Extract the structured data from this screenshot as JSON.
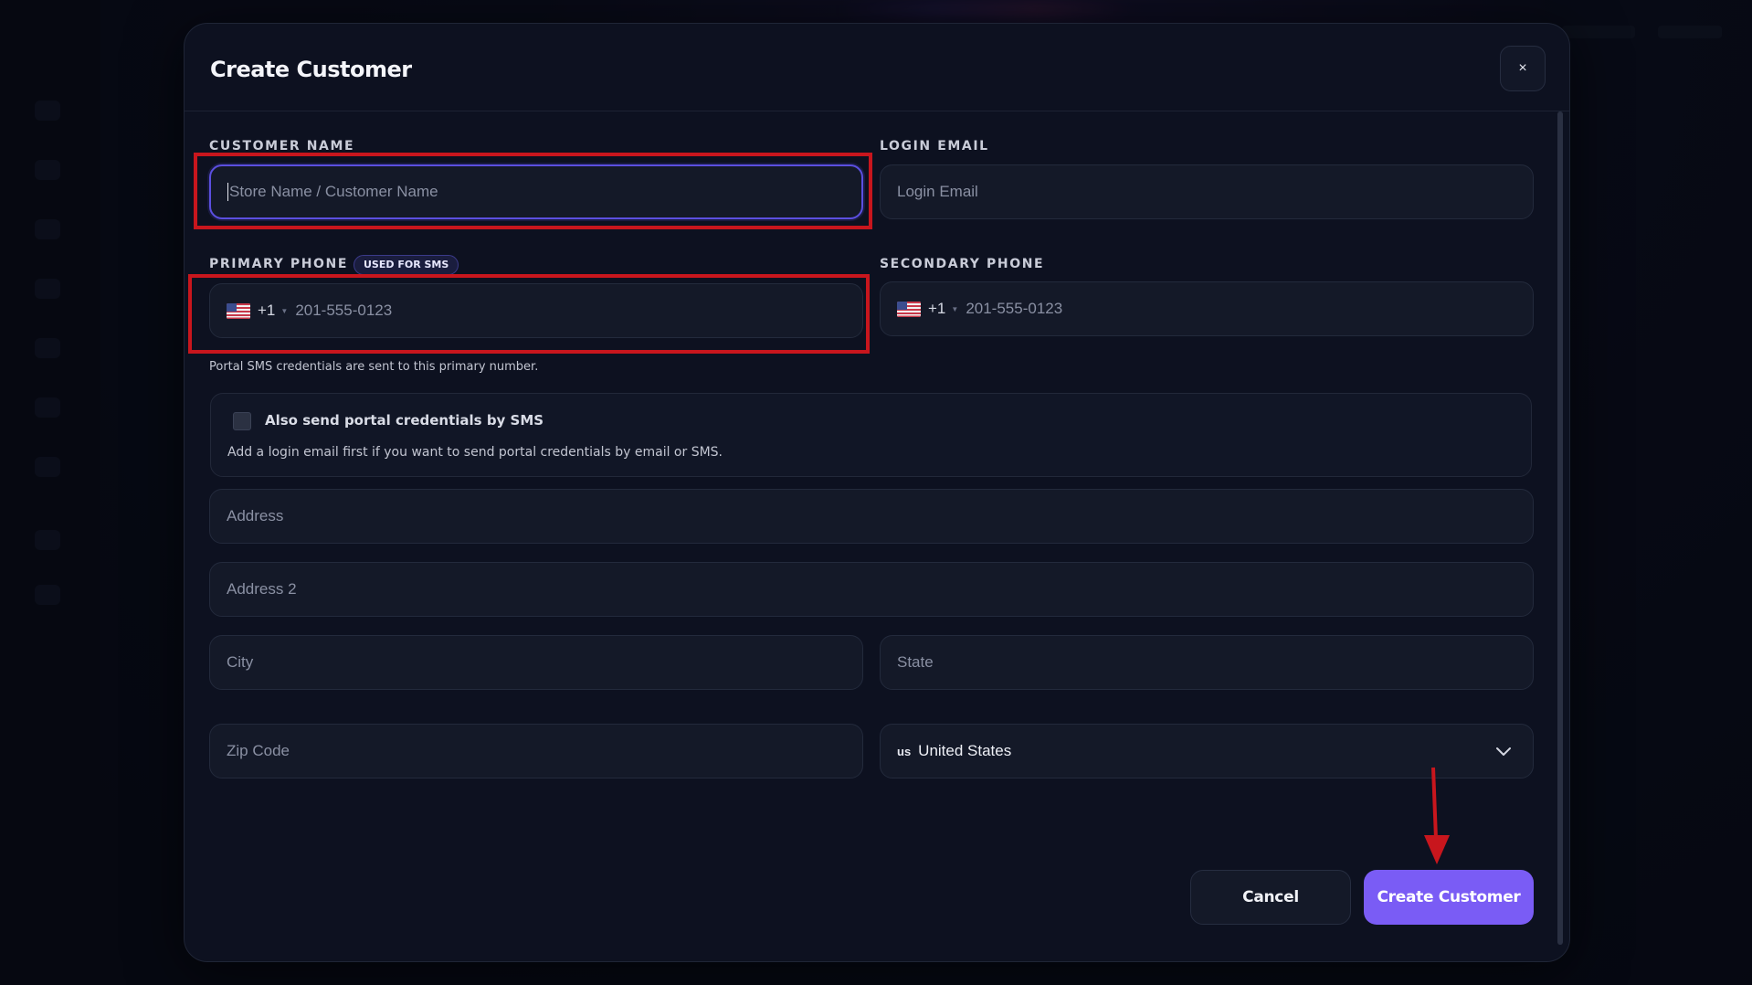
{
  "modal": {
    "title": "Create Customer",
    "close_label": "×"
  },
  "form": {
    "customer_name": {
      "label": "CUSTOMER NAME",
      "placeholder": "Store Name / Customer Name",
      "value": ""
    },
    "login_email": {
      "label": "LOGIN EMAIL",
      "placeholder": "Login Email",
      "value": ""
    },
    "primary_phone": {
      "label": "PRIMARY PHONE",
      "badge": "USED FOR SMS",
      "dial_code": "+1",
      "placeholder": "201-555-0123",
      "help": "Portal SMS credentials are sent to this primary number."
    },
    "secondary_phone": {
      "label": "SECONDARY PHONE",
      "dial_code": "+1",
      "placeholder": "201-555-0123"
    },
    "sms_option": {
      "checked": false,
      "label": "Also send portal credentials by SMS",
      "description": "Add a login email first if you want to send portal credentials by email or SMS."
    },
    "address": {
      "placeholder": "Address"
    },
    "address2": {
      "placeholder": "Address 2"
    },
    "city": {
      "placeholder": "City"
    },
    "state": {
      "placeholder": "State"
    },
    "zip": {
      "placeholder": "Zip Code"
    },
    "country": {
      "code": "us",
      "name": "United States"
    }
  },
  "actions": {
    "cancel_label": "Cancel",
    "create_label": "Create Customer"
  },
  "colors": {
    "accent": "#7a5cf5",
    "highlight_red": "#c8161d",
    "modal_bg": "#0d1120"
  },
  "icons": {
    "flag": "us-flag-icon",
    "close": "close-icon",
    "chevron": "chevron-down-icon",
    "arrow": "red-arrow-annotation"
  }
}
